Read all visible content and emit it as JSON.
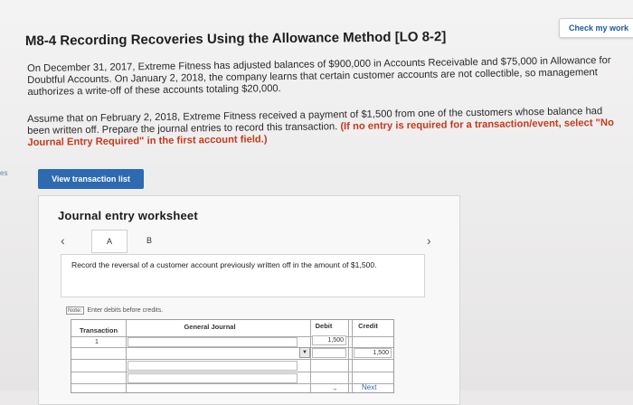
{
  "header": {
    "check_button": "Check my work",
    "title": "M8-4 Recording Recoveries Using the Allowance Method [LO 8-2]"
  },
  "problem": {
    "paragraph1": "On December 31, 2017, Extreme Fitness has adjusted balances of $900,000 in Accounts Receivable and $75,000 in Allowance for Doubtful Accounts. On January 2, 2018, the company learns that certain customer accounts are not collectible, so management authorizes a write-off of these accounts totaling $20,000.",
    "paragraph2_main": "Assume that on February 2, 2018, Extreme Fitness received a payment of $1,500 from one of the customers whose balance had been written off. Prepare the journal entries to record this transaction.",
    "paragraph2_note": "(If no entry is required for a transaction/event, select \"No Journal Entry Required\" in the first account field.)"
  },
  "side_tab": "es",
  "view_button": "View transaction list",
  "worksheet": {
    "title": "Journal entry worksheet",
    "tabs": [
      "A",
      "B"
    ],
    "instruction": "Record the reversal of a customer account previously written off in the amount of $1,500.",
    "note_label": "Note:",
    "note_text": "Enter debits before credits."
  },
  "journal": {
    "headers": {
      "transaction": "Transaction",
      "general_journal": "General Journal",
      "debit": "Debit",
      "credit": "Credit"
    },
    "row1": {
      "transaction": "1",
      "debit": "1,500",
      "credit": "1,500"
    }
  },
  "footer": {
    "dots": "...",
    "next_label": "Next"
  }
}
